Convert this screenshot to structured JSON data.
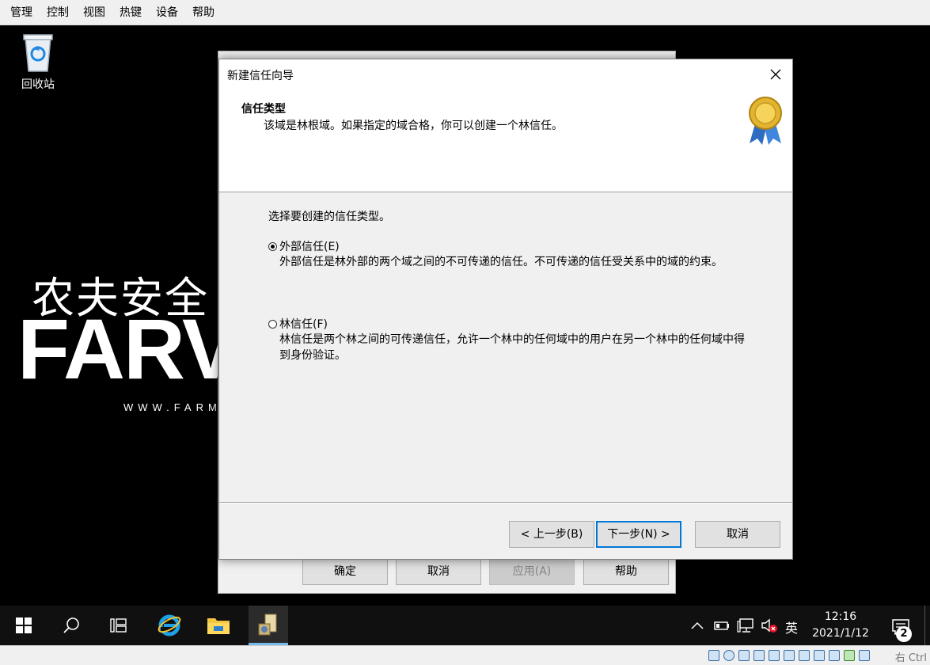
{
  "vbox_menu": [
    "管理",
    "控制",
    "视图",
    "热键",
    "设备",
    "帮助"
  ],
  "desktop": {
    "recycle_bin_label": "回收站",
    "brand_cn": "农夫安全",
    "brand_en": "FARV",
    "brand_url": "WWW.FARM"
  },
  "back_window": {
    "buttons": {
      "ok": "确定",
      "cancel": "取消",
      "apply": "应用(A)",
      "help": "帮助"
    }
  },
  "wizard": {
    "title": "新建信任向导",
    "heading": "信任类型",
    "subheading": "该域是林根域。如果指定的域合格，你可以创建一个林信任。",
    "prompt": "选择要创建的信任类型。",
    "options": [
      {
        "label": "外部信任(E)",
        "description": "外部信任是林外部的两个域之间的不可传递的信任。不可传递的信任受关系中的域的约束。",
        "selected": true
      },
      {
        "label": "林信任(F)",
        "description": "林信任是两个林之间的可传递信任，允许一个林中的任何域中的用户在另一个林中的任何域中得到身份验证。",
        "selected": false
      }
    ],
    "buttons": {
      "back": "< 上一步(B)",
      "next": "下一步(N) >",
      "cancel": "取消"
    }
  },
  "taskbar": {
    "ime": "英",
    "time": "12:16",
    "date": "2021/1/12",
    "notifications": "2"
  },
  "status_bar": {
    "host_key": "右 Ctrl"
  },
  "colors": {
    "accent": "#0078d7",
    "taskbar_bg": "#101010",
    "dialog_bg": "#f0f0f0"
  }
}
